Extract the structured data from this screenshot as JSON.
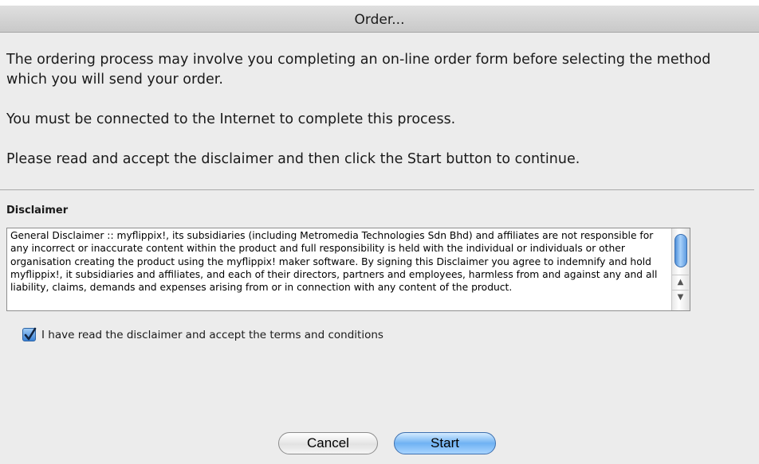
{
  "window": {
    "title": "Order..."
  },
  "intro": {
    "paragraph1": "The ordering process may involve you completing an on-line order form before selecting the method which you will send your order.",
    "paragraph2": "You must be connected to the Internet to complete this process.",
    "paragraph3": "Please read and accept the disclaimer and then click the Start button to continue."
  },
  "disclaimer": {
    "heading": "Disclaimer",
    "text": "General Disclaimer :: myflippix!, its subsidiaries (including Metromedia Technologies Sdn Bhd) and affiliates are not responsible for any incorrect or inaccurate content within the product and full responsibility is held with the individual or individuals or other organisation creating the product using the myflippix! maker software. By signing this Disclaimer you agree to indemnify and hold myflippix!, it subsidiaries and affiliates, and each of their directors, partners and employees, harmless from and against any and all liability, claims, demands and expenses arising from or in connection with any content of the product."
  },
  "accept": {
    "label": "I have read the disclaimer and accept the terms and conditions",
    "checked": true
  },
  "buttons": {
    "cancel": "Cancel",
    "start": "Start"
  },
  "colors": {
    "accent": "#6fb2f3",
    "window_background": "#ececec"
  },
  "icons": {
    "checkbox": "checkmark-icon",
    "scroll_up": "chevron-up-icon",
    "scroll_down": "chevron-down-icon"
  }
}
